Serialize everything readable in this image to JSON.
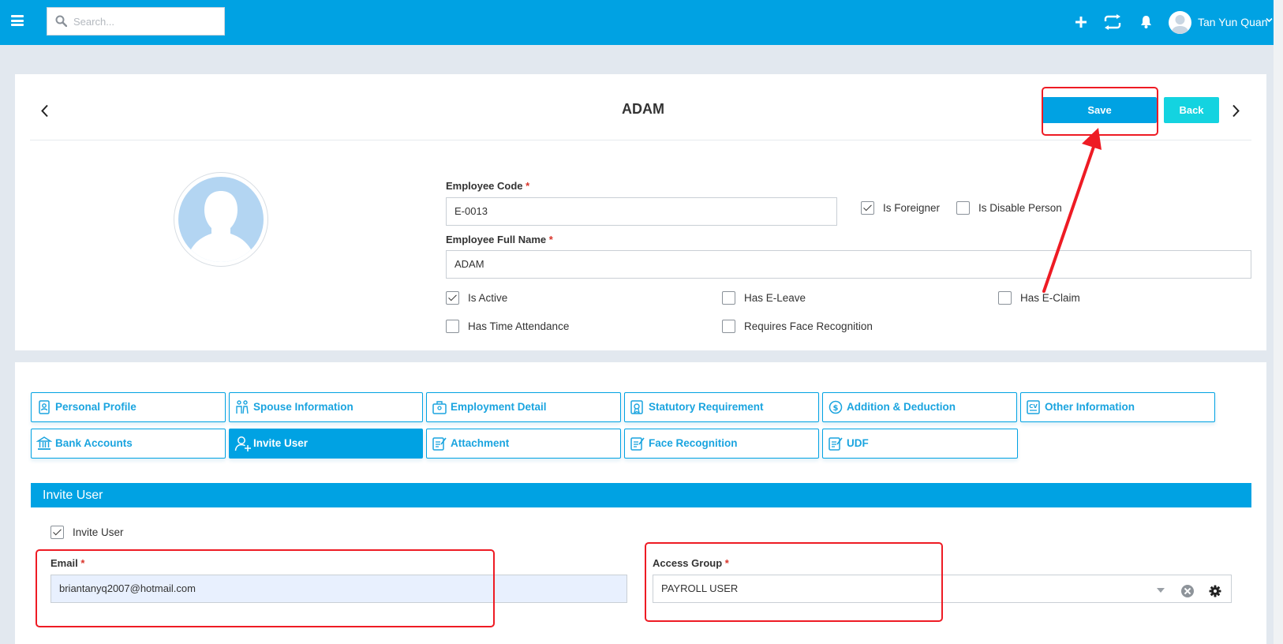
{
  "topbar": {
    "search_placeholder": "Search...",
    "user_name": "Tan Yun Quan",
    "icons": [
      "menu-icon",
      "search-icon",
      "plus-icon",
      "refresh-icon",
      "bell-icon",
      "user-avatar",
      "chevron-down-icon"
    ]
  },
  "header": {
    "title": "ADAM",
    "save_label": "Save",
    "back_label": "Back"
  },
  "form": {
    "employee_code_label": "Employee Code",
    "employee_code_value": "E-0013",
    "required_mark": "*",
    "is_foreigner": {
      "label": "Is Foreigner",
      "checked": true
    },
    "is_disable_person": {
      "label": "Is Disable Person",
      "checked": false
    },
    "full_name_label": "Employee Full Name",
    "full_name_value": "ADAM",
    "is_active": {
      "label": "Is Active",
      "checked": true
    },
    "has_e_leave": {
      "label": "Has E-Leave",
      "checked": false
    },
    "has_e_claim": {
      "label": "Has E-Claim",
      "checked": false
    },
    "has_time_attendance": {
      "label": "Has Time Attendance",
      "checked": false
    },
    "requires_face_recognition": {
      "label": "Requires Face Recognition",
      "checked": false
    }
  },
  "tabs": [
    {
      "label": "Personal Profile",
      "active": false
    },
    {
      "label": "Spouse Information",
      "active": false
    },
    {
      "label": "Employment Detail",
      "active": false
    },
    {
      "label": "Statutory Requirement",
      "active": false
    },
    {
      "label": "Addition & Deduction",
      "active": false
    },
    {
      "label": "Other Information",
      "active": false
    },
    {
      "label": "Bank Accounts",
      "active": false
    },
    {
      "label": "Invite User",
      "active": true
    },
    {
      "label": "Attachment",
      "active": false
    },
    {
      "label": "Face Recognition",
      "active": false
    },
    {
      "label": "UDF",
      "active": false
    }
  ],
  "invite": {
    "section_title": "Invite User",
    "invite_checkbox": {
      "label": "Invite User",
      "checked": true
    },
    "email_label": "Email",
    "email_value": "briantanyq2007@hotmail.com",
    "access_group_label": "Access Group",
    "access_group_value": "PAYROLL USER"
  },
  "colors": {
    "brand": "#00a2e3",
    "back_button": "#14d3e0",
    "annotation": "#ee1b24",
    "background": "#e2e8ef"
  }
}
